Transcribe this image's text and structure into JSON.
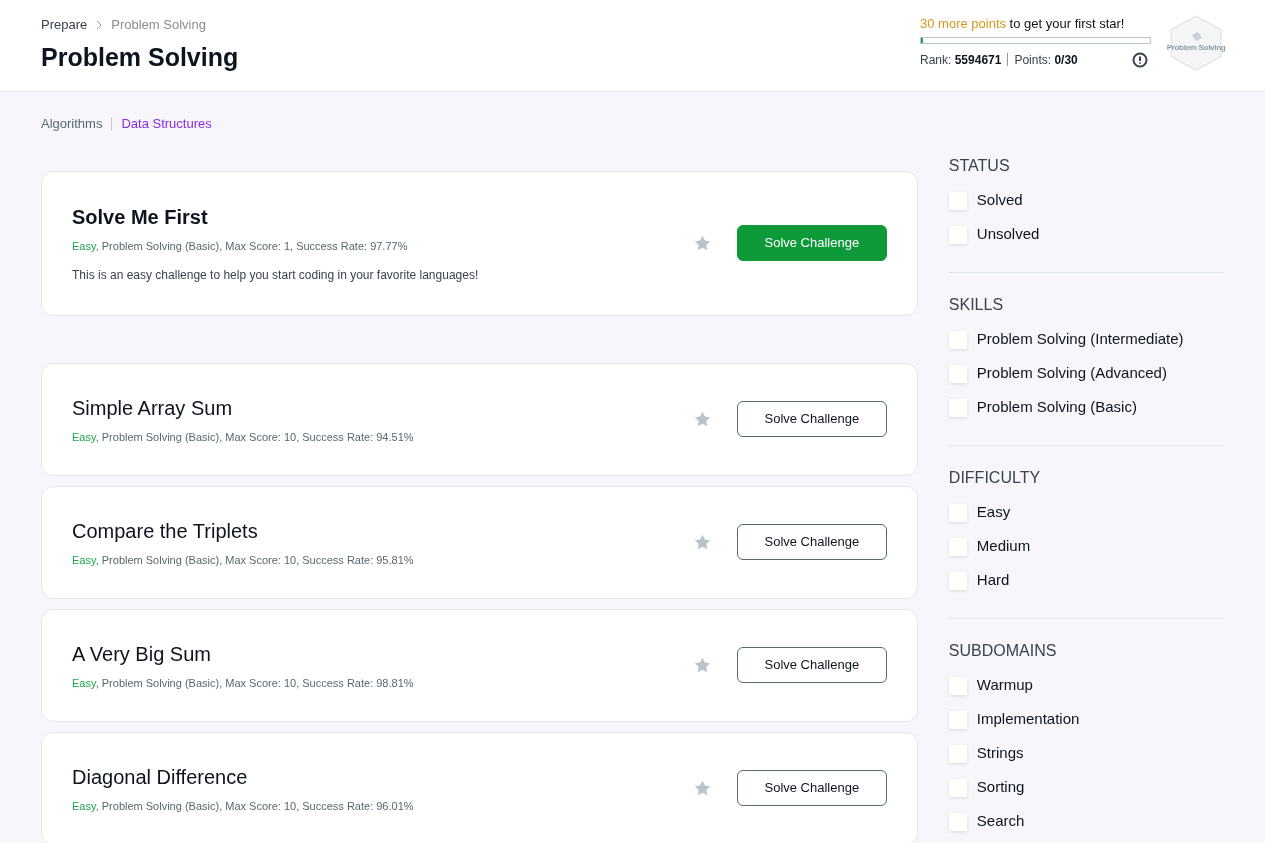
{
  "breadcrumb": [
    "Prepare",
    "Problem Solving"
  ],
  "title": "Problem Solving",
  "progress": {
    "highlight": "30 more points",
    "message": "to get your first star!",
    "level": 0.01,
    "rank_label": "Rank:",
    "rank": "5594671",
    "points_label": "Points:",
    "points": "0/30",
    "badge_label": "Problem Solving"
  },
  "tabs": [
    {
      "label": "Algorithms",
      "selected": false
    },
    {
      "label": "Data Structures",
      "selected": true
    }
  ],
  "challenges": [
    {
      "title": "Solve Me First",
      "difficulty": "Easy,",
      "details": "Problem Solving (Basic), Max Score: 1, Success Rate: 97.77%",
      "description": "This is an easy challenge to help you start coding in your favorite languages!",
      "button": {
        "label": "Solve Challenge",
        "kind": "primary"
      }
    },
    {
      "title": "Simple Array Sum",
      "difficulty": "Easy,",
      "details": "Problem Solving (Basic), Max Score: 10, Success Rate: 94.51%",
      "button": {
        "label": "Solve Challenge",
        "kind": "outline"
      }
    },
    {
      "title": "Compare the Triplets",
      "difficulty": "Easy,",
      "details": "Problem Solving (Basic), Max Score: 10, Success Rate: 95.81%",
      "button": {
        "label": "Solve Challenge",
        "kind": "outline"
      }
    },
    {
      "title": "A Very Big Sum",
      "difficulty": "Easy,",
      "details": "Problem Solving (Basic), Max Score: 10, Success Rate: 98.81%",
      "button": {
        "label": "Solve Challenge",
        "kind": "outline"
      }
    },
    {
      "title": "Diagonal Difference",
      "difficulty": "Easy,",
      "details": "Problem Solving (Basic), Max Score: 10, Success Rate: 96.01%",
      "button": {
        "label": "Solve Challenge",
        "kind": "outline"
      }
    }
  ],
  "filters": [
    {
      "heading": "STATUS",
      "options": [
        {
          "label": "Solved",
          "checked": false
        },
        {
          "label": "Unsolved",
          "checked": false
        }
      ]
    },
    {
      "heading": "SKILLS",
      "options": [
        {
          "label": "Problem Solving (Intermediate)",
          "checked": false
        },
        {
          "label": "Problem Solving (Advanced)",
          "checked": false
        },
        {
          "label": "Problem Solving (Basic)",
          "checked": false
        }
      ]
    },
    {
      "heading": "DIFFICULTY",
      "options": [
        {
          "label": "Easy",
          "checked": false
        },
        {
          "label": "Medium",
          "checked": false
        },
        {
          "label": "Hard",
          "checked": false
        }
      ]
    },
    {
      "heading": "SUBDOMAINS",
      "options": [
        {
          "label": "Warmup",
          "checked": false
        },
        {
          "label": "Implementation",
          "checked": false
        },
        {
          "label": "Strings",
          "checked": false
        },
        {
          "label": "Sorting",
          "checked": false
        },
        {
          "label": "Search",
          "checked": false
        }
      ]
    }
  ]
}
